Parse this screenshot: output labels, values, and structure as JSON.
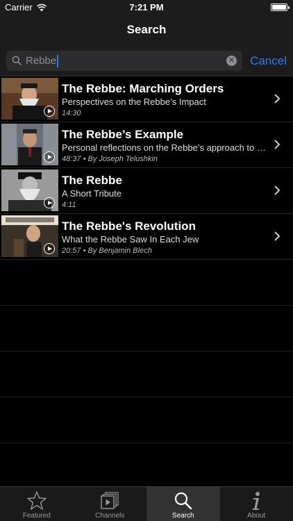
{
  "status_bar": {
    "carrier": "Carrier",
    "time": "7:21 PM"
  },
  "nav": {
    "title": "Search"
  },
  "search": {
    "value": "Rebbe",
    "cancel_label": "Cancel"
  },
  "results": [
    {
      "title": "The Rebbe: Marching Orders",
      "subtitle": "Perspectives on the Rebbe’s Impact",
      "meta": "14:30"
    },
    {
      "title": "The Rebbe’s Example",
      "subtitle": "Personal reflections on the Rebbe’s approach to lea...",
      "meta": "48:37 • By Joseph Telushkin"
    },
    {
      "title": "The Rebbe",
      "subtitle": "A Short Tribute",
      "meta": "4:11"
    },
    {
      "title": "The Rebbe's Revolution",
      "subtitle": "What the Rebbe Saw In Each Jew",
      "meta": "20:57 • By Benjamin Blech"
    }
  ],
  "tabs": [
    {
      "label": "Featured",
      "icon": "star-icon"
    },
    {
      "label": "Channels",
      "icon": "channels-icon"
    },
    {
      "label": "Search",
      "icon": "search-icon"
    },
    {
      "label": "About",
      "icon": "info-icon"
    }
  ],
  "colors": {
    "accent": "#2f7cf6",
    "background": "#000000",
    "bar": "#1c1c1c"
  }
}
